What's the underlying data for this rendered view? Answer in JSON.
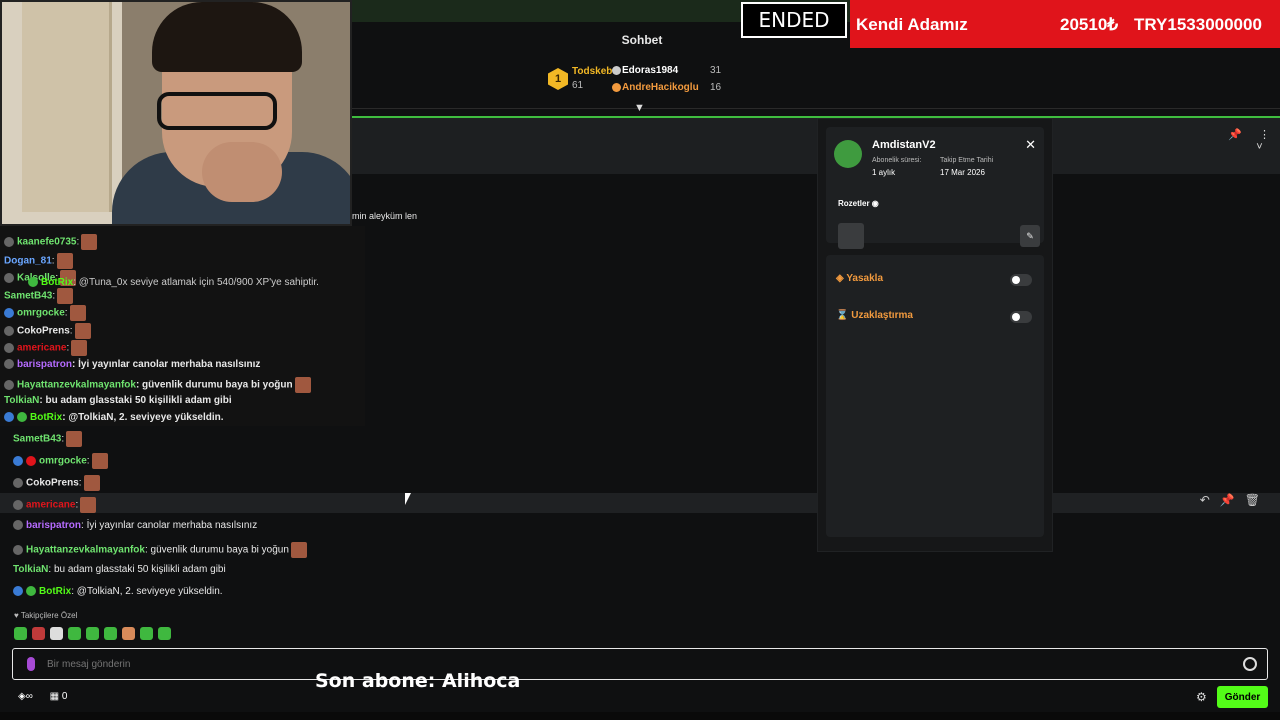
{
  "header": {
    "chat_title": "Sohbet",
    "ended_label": "ENDED",
    "ticker": {
      "name": "Kendi Adamız",
      "amount1": "20510₺",
      "amount2": "TRY1533000000"
    }
  },
  "podium": {
    "first": {
      "rank": "1",
      "name": "Todskebt",
      "count": "61"
    },
    "second": {
      "name": "Edoras1984",
      "count": "31"
    },
    "third": {
      "name": "AndreHacikoglu",
      "count": "16"
    }
  },
  "pinned_fragment": "min aleyküm len",
  "overlay_chat": [
    {
      "user": "kaanefe0735",
      "text": ":"
    },
    {
      "user": "Dogan_81",
      "text": ":"
    },
    {
      "user": "Kalsolle",
      "text": ":"
    },
    {
      "user": "BotRix",
      "text": ": @Tuna_0x seviye atlamak için 540/900 XP'ye sahiptir."
    },
    {
      "user": "SametB43",
      "text": ":"
    },
    {
      "user": "omrgocke",
      "text": ":"
    },
    {
      "user": "CokoPrens",
      "text": ":"
    },
    {
      "user": "americane",
      "text": ":"
    },
    {
      "user": "barispatron",
      "text": ": İyi yayınlar canolar merhaba nasılsınız"
    },
    {
      "user": "Hayattanzevkalmayanfok",
      "text": ": güvenlik durumu baya bi yoğun"
    },
    {
      "user": "TolkiaN",
      "text": ": bu adam glasstaki 50 kişilikli adam gibi"
    },
    {
      "user": "BotRix",
      "text": ": @TolkiaN, 2. seviyeye yükseldin."
    }
  ],
  "chat": [
    {
      "user": "SametB43",
      "text": ":"
    },
    {
      "user": "omrgocke",
      "text": ":"
    },
    {
      "user": "CokoPrens",
      "text": ":"
    },
    {
      "user": "americane",
      "text": ":"
    },
    {
      "user": "barispatron",
      "text": ": İyi yayınlar canolar merhaba nasılsınız"
    },
    {
      "user": "Hayattanzevkalmayanfok",
      "text": ": güvenlik durumu baya bi yoğun"
    },
    {
      "user": "TolkiaN",
      "text": ": bu adam glasstaki 50 kişilikli adam gibi"
    },
    {
      "user": "BotRix",
      "text": ": @TolkiaN, 2. seviyeye yükseldin."
    }
  ],
  "follower_only": "Takipçilere Özel",
  "user_panel": {
    "name": "AmdistanV2",
    "sub_label": "Abonelik süresi:",
    "sub_value": "1 aylık",
    "follow_label": "Takip Etme Tarihi",
    "follow_value": "17 Mar 2026",
    "badges_label": "Rozetler",
    "ban_label": "Yasakla",
    "timeout_label": "Uzaklaştırma"
  },
  "input": {
    "placeholder": "Bir mesaj gönderin"
  },
  "bottom": {
    "viewer_count": "0",
    "send_label": "Gönder"
  },
  "stream_overlay": {
    "last_sub": "Son abone: Alihoca"
  },
  "colors": {
    "accent": "#53fc18",
    "ticker": "#e0141b",
    "warning": "#f29a3e"
  }
}
